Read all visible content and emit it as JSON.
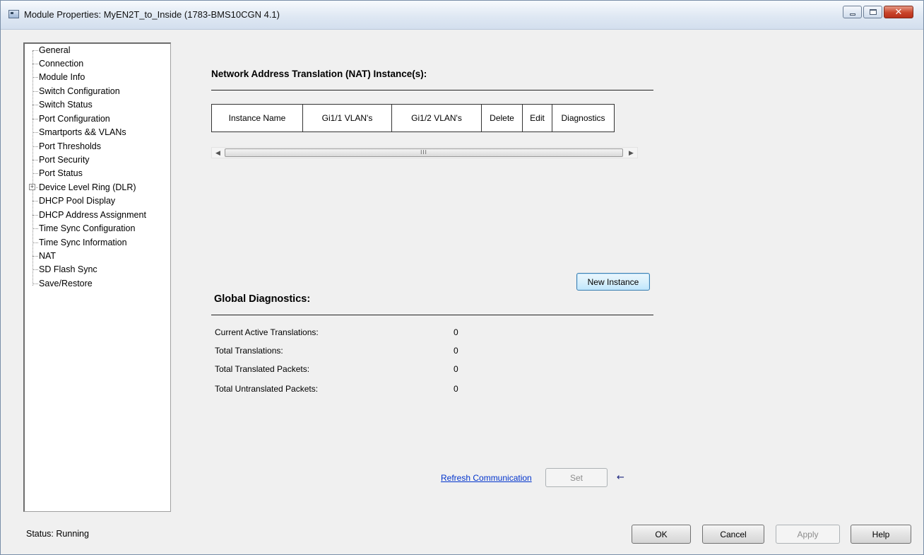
{
  "window": {
    "title": "Module Properties: MyEN2T_to_Inside (1783-BMS10CGN 4.1)",
    "controls": [
      "minimize-icon",
      "maximize-icon",
      "close-icon"
    ]
  },
  "sidebar": {
    "items": [
      {
        "label": "General"
      },
      {
        "label": "Connection"
      },
      {
        "label": "Module Info"
      },
      {
        "label": "Switch Configuration"
      },
      {
        "label": "Switch Status"
      },
      {
        "label": "Port Configuration"
      },
      {
        "label": "Smartports && VLANs"
      },
      {
        "label": "Port Thresholds"
      },
      {
        "label": "Port Security"
      },
      {
        "label": "Port Status"
      },
      {
        "label": "Device Level Ring (DLR)",
        "expandable": true
      },
      {
        "label": "DHCP Pool Display"
      },
      {
        "label": "DHCP Address Assignment"
      },
      {
        "label": "Time Sync Configuration"
      },
      {
        "label": "Time Sync Information"
      },
      {
        "label": "NAT"
      },
      {
        "label": "SD Flash Sync"
      },
      {
        "label": "Save/Restore"
      }
    ],
    "selected": "NAT"
  },
  "nat": {
    "heading": "Network Address Translation (NAT) Instance(s):",
    "columns": [
      "Instance Name",
      "Gi1/1 VLAN's",
      "Gi1/2 VLAN's",
      "Delete",
      "Edit",
      "Diagnostics"
    ],
    "rows": [],
    "scrollbar_thumb": "III",
    "new_instance_label": "New Instance"
  },
  "global": {
    "heading": "Global Diagnostics:",
    "stats": [
      {
        "label": "Current Active Translations:",
        "value": "0"
      },
      {
        "label": "Total Translations:",
        "value": "0"
      },
      {
        "label": "Total Translated Packets:",
        "value": "0"
      },
      {
        "label": "Total Untranslated Packets:",
        "value": "0"
      }
    ]
  },
  "actions": {
    "refresh_label": "Refresh Communication",
    "set_label": "Set",
    "arrow_glyph": "←"
  },
  "footer": {
    "status": "Status:  Running",
    "ok_label": "OK",
    "cancel_label": "Cancel",
    "apply_label": "Apply",
    "help_label": "Help"
  }
}
